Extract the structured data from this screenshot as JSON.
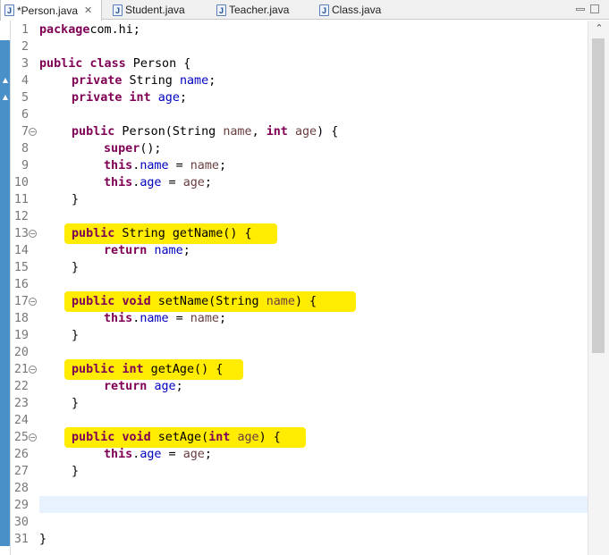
{
  "tabs": [
    {
      "label": "*Person.java",
      "active": true,
      "closable": true,
      "icon": "java-file-icon"
    },
    {
      "label": "Student.java",
      "active": false,
      "icon": "java-file-icon"
    },
    {
      "label": "Teacher.java",
      "active": false,
      "icon": "java-file-icon"
    },
    {
      "label": "Class.java",
      "active": false,
      "icon": "java-file-icon"
    }
  ],
  "window_controls": [
    "minimize-icon",
    "maximize-icon"
  ],
  "highlight_color": "#ffec00",
  "editor": {
    "lines": [
      {
        "n": "1",
        "tokens": [
          [
            "kw",
            "package"
          ],
          [
            "",
            "com.hi;"
          ]
        ]
      },
      {
        "n": "2",
        "tokens": []
      },
      {
        "n": "3",
        "tokens": [
          [
            "kw",
            "public"
          ],
          [
            "",
            " "
          ],
          [
            "kw",
            "class"
          ],
          [
            "",
            " Person {"
          ]
        ]
      },
      {
        "n": "4",
        "tokens": [
          [
            "",
            " "
          ],
          [
            "kw",
            "private"
          ],
          [
            "",
            " String "
          ],
          [
            "fld",
            "name"
          ],
          [
            "",
            ";"
          ]
        ],
        "marker": true
      },
      {
        "n": "5",
        "tokens": [
          [
            "",
            " "
          ],
          [
            "kw",
            "private"
          ],
          [
            "",
            " "
          ],
          [
            "kw",
            "int"
          ],
          [
            "",
            " "
          ],
          [
            "fld",
            "age"
          ],
          [
            "",
            ";"
          ]
        ],
        "marker": true
      },
      {
        "n": "6",
        "tokens": []
      },
      {
        "n": "7",
        "fold": true,
        "tokens": [
          [
            "",
            " "
          ],
          [
            "kw",
            "public"
          ],
          [
            "",
            " Person(String "
          ],
          [
            "par",
            "name"
          ],
          [
            "",
            ", "
          ],
          [
            "kw",
            "int"
          ],
          [
            "",
            " "
          ],
          [
            "par",
            "age"
          ],
          [
            "",
            ") {"
          ]
        ]
      },
      {
        "n": "8",
        "tokens": [
          [
            "",
            " "
          ],
          [
            "kw",
            "super"
          ],
          [
            "",
            "();"
          ]
        ]
      },
      {
        "n": "9",
        "tokens": [
          [
            "",
            " "
          ],
          [
            "kw",
            "this"
          ],
          [
            "",
            "."
          ],
          [
            "fld",
            "name"
          ],
          [
            "",
            " = "
          ],
          [
            "par",
            "name"
          ],
          [
            "",
            ";"
          ]
        ]
      },
      {
        "n": "10",
        "tokens": [
          [
            "",
            " "
          ],
          [
            "kw",
            "this"
          ],
          [
            "",
            "."
          ],
          [
            "fld",
            "age"
          ],
          [
            "",
            " = "
          ],
          [
            "par",
            "age"
          ],
          [
            "",
            ";"
          ]
        ]
      },
      {
        "n": "11",
        "tokens": [
          [
            "",
            " }"
          ]
        ]
      },
      {
        "n": "12",
        "tokens": []
      },
      {
        "n": "13",
        "fold": true,
        "highlight": true,
        "tokens": [
          [
            "",
            " "
          ],
          [
            "kw",
            "public"
          ],
          [
            "",
            " String getName() {"
          ]
        ]
      },
      {
        "n": "14",
        "tokens": [
          [
            "",
            " "
          ],
          [
            "kw",
            "return"
          ],
          [
            "",
            " "
          ],
          [
            "fld",
            "name"
          ],
          [
            "",
            ";"
          ]
        ]
      },
      {
        "n": "15",
        "tokens": [
          [
            "",
            " }"
          ]
        ]
      },
      {
        "n": "16",
        "tokens": []
      },
      {
        "n": "17",
        "fold": true,
        "highlight": true,
        "tokens": [
          [
            "",
            " "
          ],
          [
            "kw",
            "public"
          ],
          [
            "",
            " "
          ],
          [
            "kw",
            "void"
          ],
          [
            "",
            " setName(String "
          ],
          [
            "par",
            "name"
          ],
          [
            "",
            ") {"
          ]
        ]
      },
      {
        "n": "18",
        "tokens": [
          [
            "",
            " "
          ],
          [
            "kw",
            "this"
          ],
          [
            "",
            "."
          ],
          [
            "fld",
            "name"
          ],
          [
            "",
            " = "
          ],
          [
            "par",
            "name"
          ],
          [
            "",
            ";"
          ]
        ]
      },
      {
        "n": "19",
        "tokens": [
          [
            "",
            " }"
          ]
        ]
      },
      {
        "n": "20",
        "tokens": []
      },
      {
        "n": "21",
        "fold": true,
        "highlight": true,
        "tokens": [
          [
            "",
            " "
          ],
          [
            "kw",
            "public"
          ],
          [
            "",
            " "
          ],
          [
            "kw",
            "int"
          ],
          [
            "",
            " getAge() {"
          ]
        ]
      },
      {
        "n": "22",
        "tokens": [
          [
            "",
            " "
          ],
          [
            "kw",
            "return"
          ],
          [
            "",
            " "
          ],
          [
            "fld",
            "age"
          ],
          [
            "",
            ";"
          ]
        ]
      },
      {
        "n": "23",
        "tokens": [
          [
            "",
            " }"
          ]
        ]
      },
      {
        "n": "24",
        "tokens": []
      },
      {
        "n": "25",
        "fold": true,
        "highlight": true,
        "tokens": [
          [
            "",
            " "
          ],
          [
            "kw",
            "public"
          ],
          [
            "",
            " "
          ],
          [
            "kw",
            "void"
          ],
          [
            "",
            " setAge("
          ],
          [
            "kw",
            "int"
          ],
          [
            "",
            " "
          ],
          [
            "par",
            "age"
          ],
          [
            "",
            ") {"
          ]
        ]
      },
      {
        "n": "26",
        "tokens": [
          [
            "",
            " "
          ],
          [
            "kw",
            "this"
          ],
          [
            "",
            "."
          ],
          [
            "fld",
            "age"
          ],
          [
            "",
            " = "
          ],
          [
            "par",
            "age"
          ],
          [
            "",
            ";"
          ]
        ]
      },
      {
        "n": "27",
        "tokens": [
          [
            "",
            " }"
          ]
        ]
      },
      {
        "n": "28",
        "tokens": []
      },
      {
        "n": "29",
        "tokens": [],
        "current": true
      },
      {
        "n": "30",
        "tokens": []
      },
      {
        "n": "31",
        "tokens": [
          [
            "",
            "}"
          ]
        ]
      }
    ]
  }
}
